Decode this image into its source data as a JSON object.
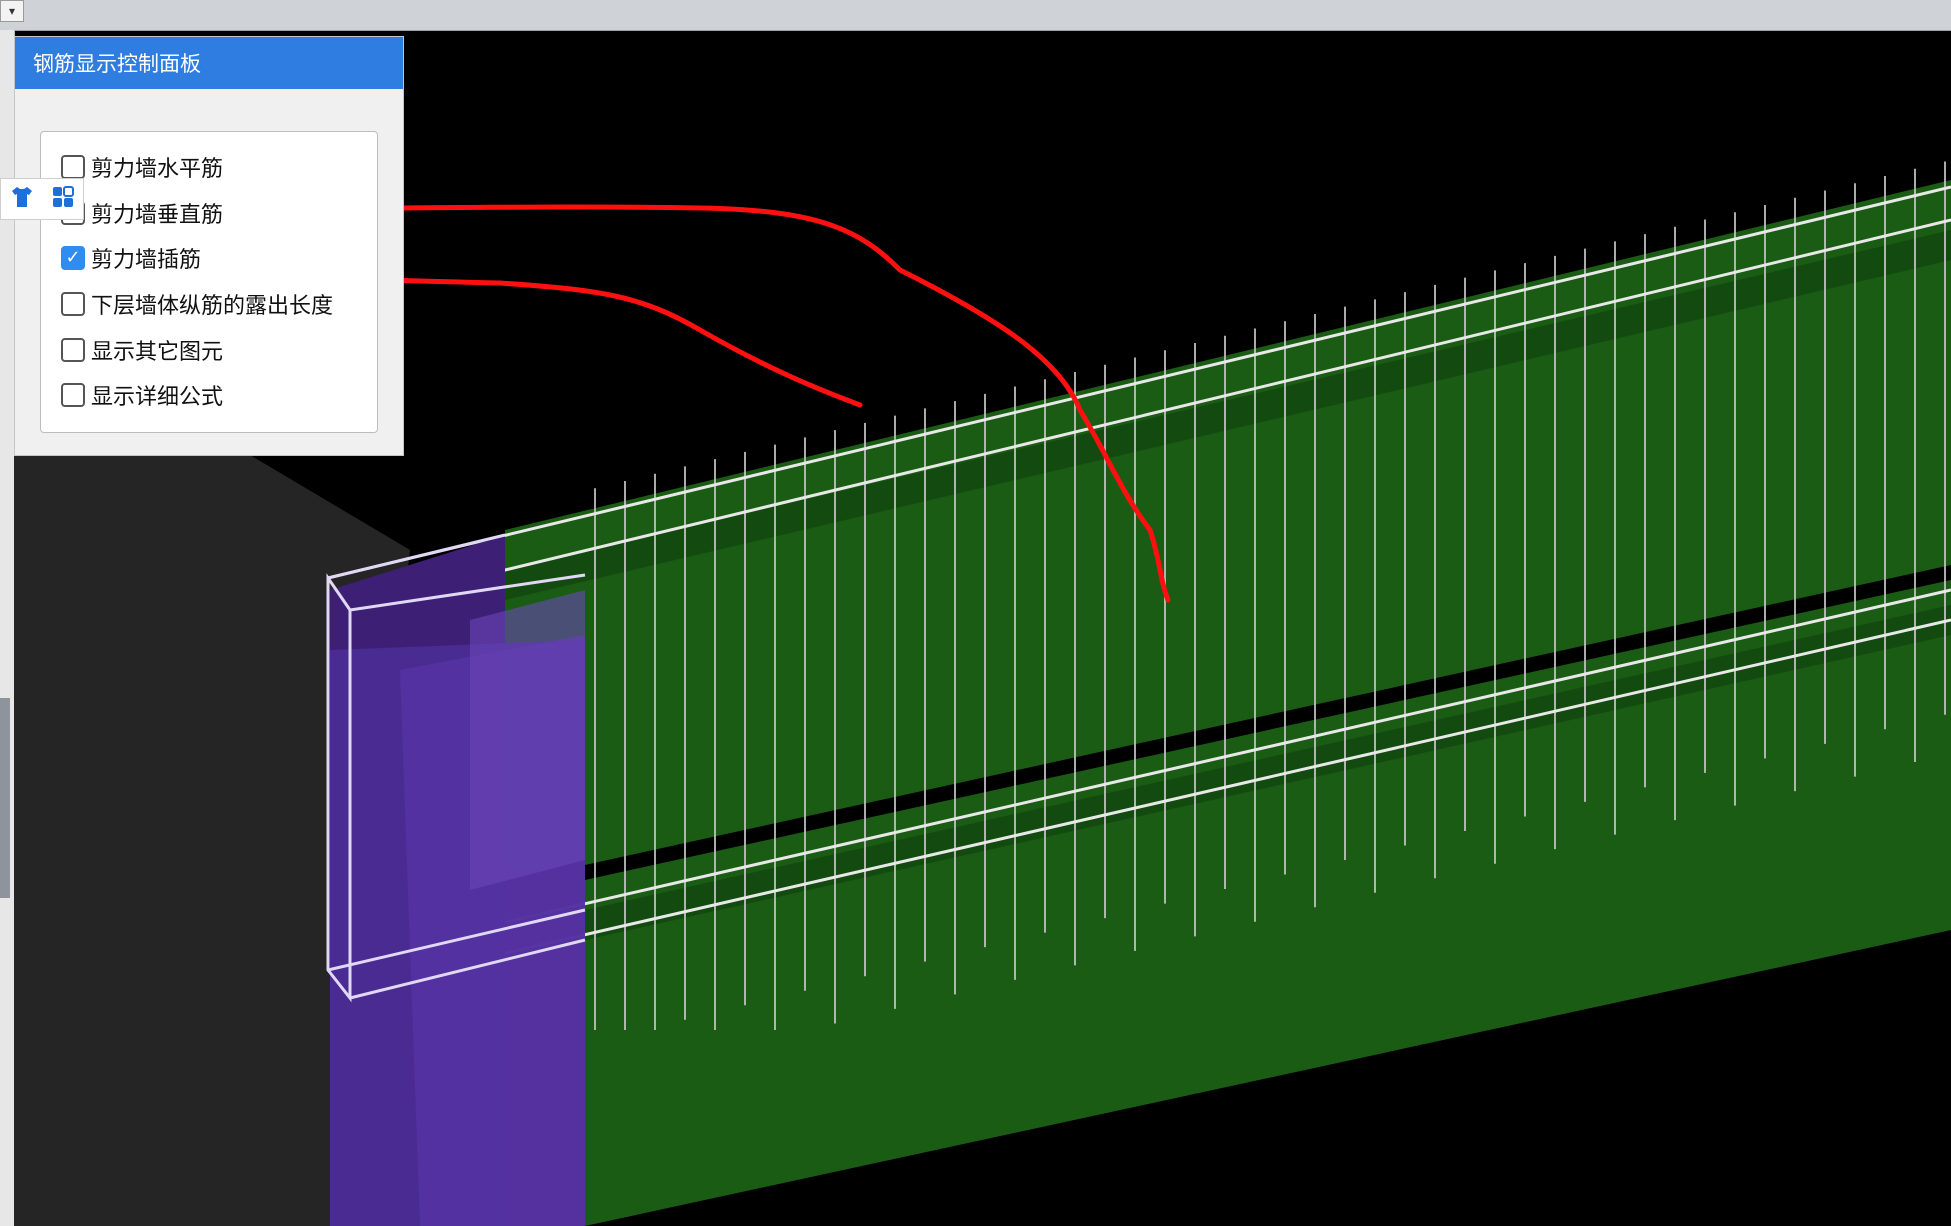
{
  "panel": {
    "title": "钢筋显示控制面板",
    "options": [
      {
        "label": "剪力墙水平筋",
        "checked": false
      },
      {
        "label": "剪力墙垂直筋",
        "checked": false
      },
      {
        "label": "剪力墙插筋",
        "checked": true
      },
      {
        "label": "下层墙体纵筋的露出长度",
        "checked": false
      },
      {
        "label": "显示其它图元",
        "checked": false
      },
      {
        "label": "显示详细公式",
        "checked": false
      }
    ]
  },
  "floating_toolbar": {
    "icons": [
      "shirt-icon",
      "grid-icon"
    ]
  },
  "colors": {
    "accent": "#2f7de1",
    "wall": "#1a5c14",
    "column": "#4a2a8c",
    "annotation": "#ff1010"
  },
  "corner_dropdown_glyph": "▾"
}
